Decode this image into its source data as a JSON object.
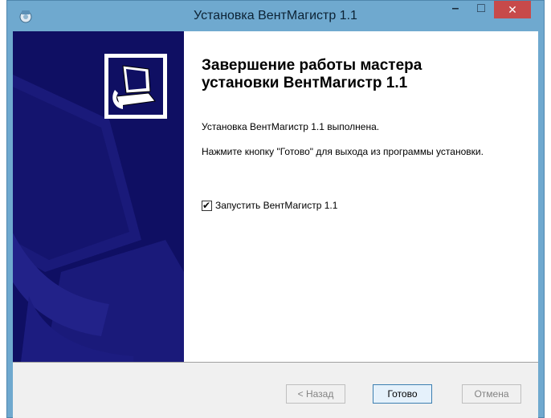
{
  "window": {
    "title": "Установка ВентМагистр 1.1",
    "controls": {
      "minimize": "–",
      "maximize": "□",
      "close": "✕"
    }
  },
  "main": {
    "heading_line1": "Завершение работы мастера",
    "heading_line2": "установки ВентМагистр 1.1",
    "status_text": "Установка ВентМагистр 1.1 выполнена.",
    "instruction_text": "Нажмите кнопку \"Готово\" для выхода из программы установки.",
    "run_checkbox": {
      "label": "Запустить ВентМагистр 1.1",
      "checked": true
    }
  },
  "buttons": {
    "back": "< Назад",
    "finish": "Готово",
    "cancel": "Отмена"
  },
  "colors": {
    "titlebar": "#6fa9cf",
    "sidebar": "#0f0f63",
    "close_button": "#c74a4a"
  }
}
